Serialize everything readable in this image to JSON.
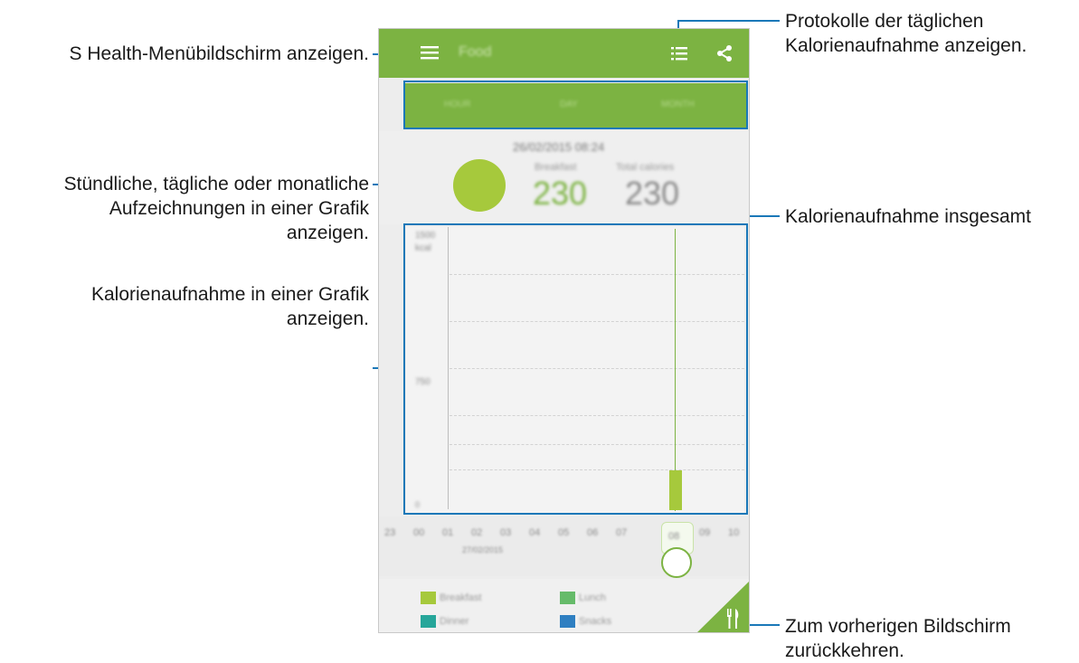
{
  "callouts": {
    "menu": "S Health-Menübildschirm anzeigen.",
    "logs_line1": "Protokolle der täglichen",
    "logs_line2": "Kalorienaufnahme anzeigen.",
    "tabs_line1": "Stündliche, tägliche oder monatliche",
    "tabs_line2": "Aufzeichnungen in einer Grafik",
    "tabs_line3": "anzeigen.",
    "total": "Kalorienaufnahme insgesamt",
    "graph_line1": "Kalorienaufnahme in einer Grafik",
    "graph_line2": "anzeigen.",
    "back_line1": "Zum vorherigen Bildschirm",
    "back_line2": "zurückkehren."
  },
  "app": {
    "title": "Food",
    "tabs": [
      "HOUR",
      "DAY",
      "MONTH"
    ],
    "datetime": "26/02/2015 08:24",
    "meal_label": "Breakfast",
    "meal_value": "230",
    "total_label": "Total calories",
    "total_value": "230",
    "y_top": "1500",
    "y_unit": "kcal",
    "y_mid": "750",
    "y_zero": "0",
    "hours": [
      "23",
      "00",
      "01",
      "02",
      "03",
      "04",
      "05",
      "06",
      "07",
      "08",
      "09",
      "10"
    ],
    "date_label": "27/02/2015",
    "selected_hour": "08",
    "legend": [
      "Breakfast",
      "Lunch",
      "Dinner",
      "Snacks"
    ]
  },
  "colors": {
    "app_green": "#7cb342",
    "breakfast": "#a6c93c",
    "lunch": "#66bb6a",
    "dinner": "#26a69a",
    "snacks": "#2f7fc1",
    "callout_blue": "#1a78b8"
  },
  "icons": [
    "menu-icon",
    "list-icon",
    "share-icon",
    "fork-knife-icon"
  ]
}
